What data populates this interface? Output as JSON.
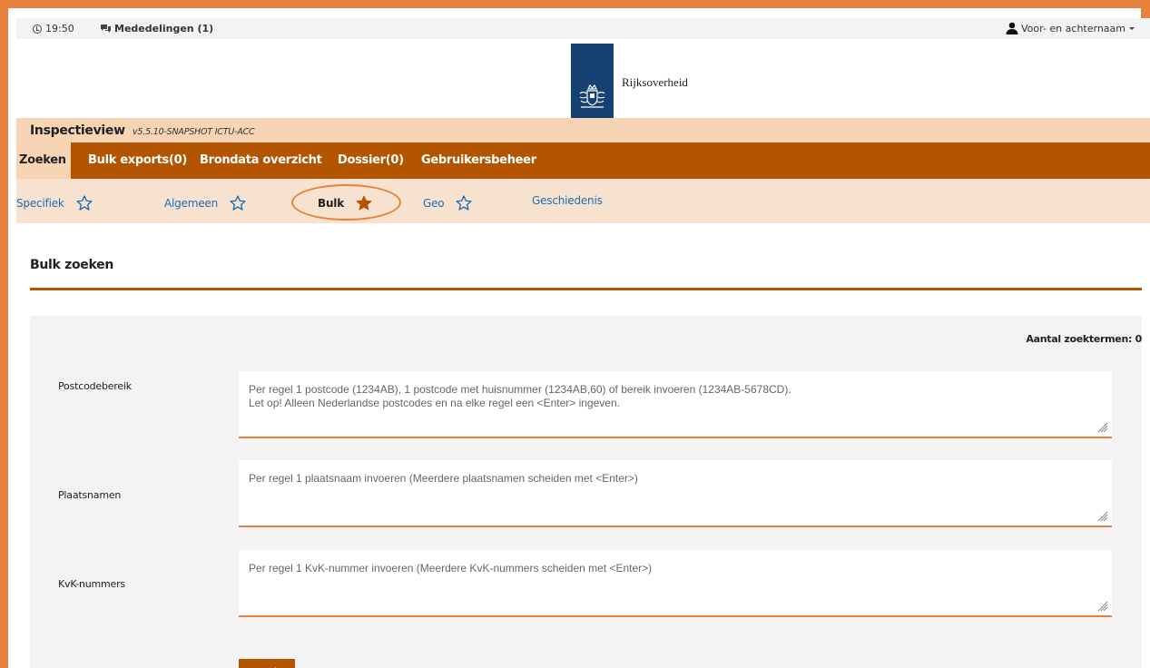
{
  "utilbar": {
    "time": "19:50",
    "messages_label": "Mededelingen (1)",
    "user_label": "Voor- en achternaam"
  },
  "logo": {
    "text": "Rijksoverheid"
  },
  "app": {
    "name": "Inspectieview",
    "version": "v5.5.10-SNAPSHOT ICTU-ACC"
  },
  "mainnav": {
    "items": [
      {
        "label": "Zoeken"
      },
      {
        "label": "Bulk exports(0)"
      },
      {
        "label": "Brondata overzicht"
      },
      {
        "label": "Dossier(0)"
      },
      {
        "label": "Gebruikersbeheer"
      }
    ]
  },
  "subnav": {
    "items": [
      {
        "label": "Specifiek"
      },
      {
        "label": "Algemeen"
      },
      {
        "label": "Bulk"
      },
      {
        "label": "Geo"
      },
      {
        "label": "Geschiedenis"
      }
    ]
  },
  "main": {
    "title": "Bulk zoeken",
    "count_label": "Aantal zoektermen: 0",
    "fields": [
      {
        "label": "Postcodebereik",
        "placeholder": "Per regel 1 postcode (1234AB), 1 postcode met huisnummer (1234AB,60) of bereik invoeren (1234AB-5678CD).\nLet op! Alleen Nederlandse postcodes en na elke regel een <Enter> ingeven."
      },
      {
        "label": "Plaatsnamen",
        "placeholder": "Per regel 1 plaatsnaam invoeren (Meerdere plaatsnamen scheiden met <Enter>)"
      },
      {
        "label": "KvK-nummers",
        "placeholder": "Per regel 1 KvK-nummer invoeren (Meerdere KvK-nummers scheiden met <Enter>)"
      }
    ],
    "submit_label": "Zoek"
  },
  "colors": {
    "brand_orange": "#b35500",
    "accent_orange": "#e8823a",
    "title_bar": "#f7d4b4",
    "subnav_bg": "#f7e2d0",
    "logo_blue": "#154273",
    "link_blue": "#1a6db5"
  }
}
